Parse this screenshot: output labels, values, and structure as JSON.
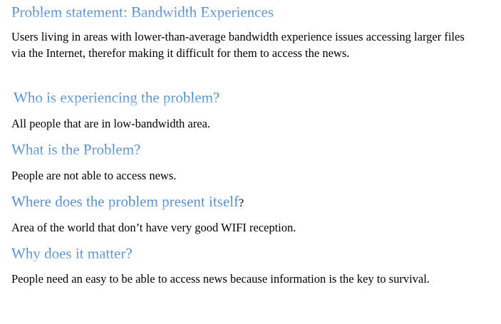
{
  "document": {
    "sections": [
      {
        "heading": "Problem statement: Bandwidth Experiences",
        "body": "Users living in areas with lower-than-average bandwidth experience issues accessing larger files via the Internet, therefor making it difficult for them to access the news."
      },
      {
        "heading": "Who is experiencing the problem?",
        "body": "All people that are in low-bandwidth area."
      },
      {
        "heading": "What is the Problem?",
        "body": "People are not able to access news."
      },
      {
        "heading": "Where does the problem present itself",
        "heading_suffix": "?",
        "body": "Area of the world that don’t have very good WIFI reception."
      },
      {
        "heading": "Why does it matter?",
        "body": "People need an easy to be able to access news because information is the key to survival."
      }
    ]
  },
  "colors": {
    "heading": "#4f86c6",
    "body_text": "#000000",
    "background": "#ffffff"
  }
}
